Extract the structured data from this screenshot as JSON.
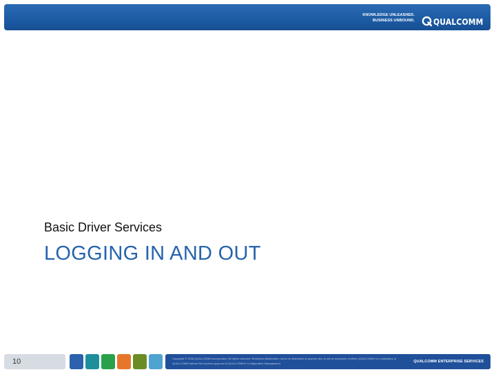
{
  "header": {
    "tagline_line1": "KNOWLEDGE UNLEASHED.",
    "tagline_line2": "BUSINESS UNBOUND.",
    "logo_text": "QUALCOMM"
  },
  "slide": {
    "subtitle": "Basic Driver Services",
    "title": "LOGGING IN AND OUT"
  },
  "footer": {
    "page_number": "10",
    "disclaimer": "Copyright © 2008 QUALCOMM Incorporated. All rights reserved. Restricted distribution: not to be distributed to anyone who is not an employee of either QUALCOMM or a subsidiary of QUALCOMM without the express approval of QUALCOMM's Configuration Management.",
    "brand": "QUALCOMM ENTERPRISE SERVICES",
    "swatch_colors": [
      "#2b61ad",
      "#1d8f9c",
      "#2aa04a",
      "#e6772a",
      "#6b8c25",
      "#4fa3d0"
    ]
  }
}
